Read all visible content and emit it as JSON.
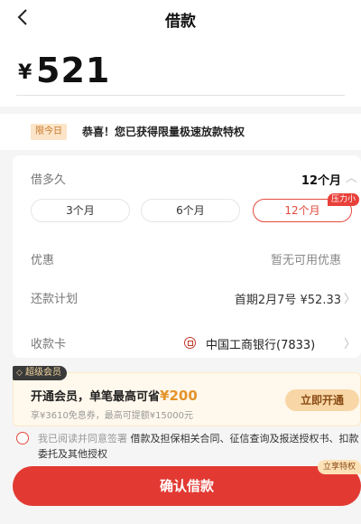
{
  "header": {
    "back_icon": "chevron-left-icon",
    "title": "借款"
  },
  "amount": {
    "currency": "¥",
    "value": "521"
  },
  "promo": {
    "badge": "限今日",
    "text": "恭喜！您已获得限量极速放款特权"
  },
  "term": {
    "label": "借多久",
    "selected": "12个月",
    "options": [
      "3个月",
      "6个月",
      "12个月"
    ],
    "selected_index": 2,
    "badge": "压力小"
  },
  "discount": {
    "label": "优惠",
    "value": "暂无可用优惠"
  },
  "plan": {
    "label": "还款计划",
    "value": "首期2月7号 ¥52.33"
  },
  "card": {
    "label": "收款卡",
    "bank": "中国工商银行(7833)"
  },
  "vip": {
    "tag": "超级会员",
    "title_prefix": "开通会员，单笔最高可省",
    "title_amount": "¥200",
    "sub": "享¥3610免息券，最高可提额¥15000元",
    "button": "立即开通"
  },
  "agreement": {
    "prefix": "我已阅读并同意签署",
    "links": "借款及担保相关合同、征信查询及报送授权书、扣款委托及其他授权"
  },
  "confirm": {
    "label": "确认借款",
    "tag": "立享特权"
  },
  "colors": {
    "accent": "#e23a33",
    "gold": "#e3932a"
  }
}
